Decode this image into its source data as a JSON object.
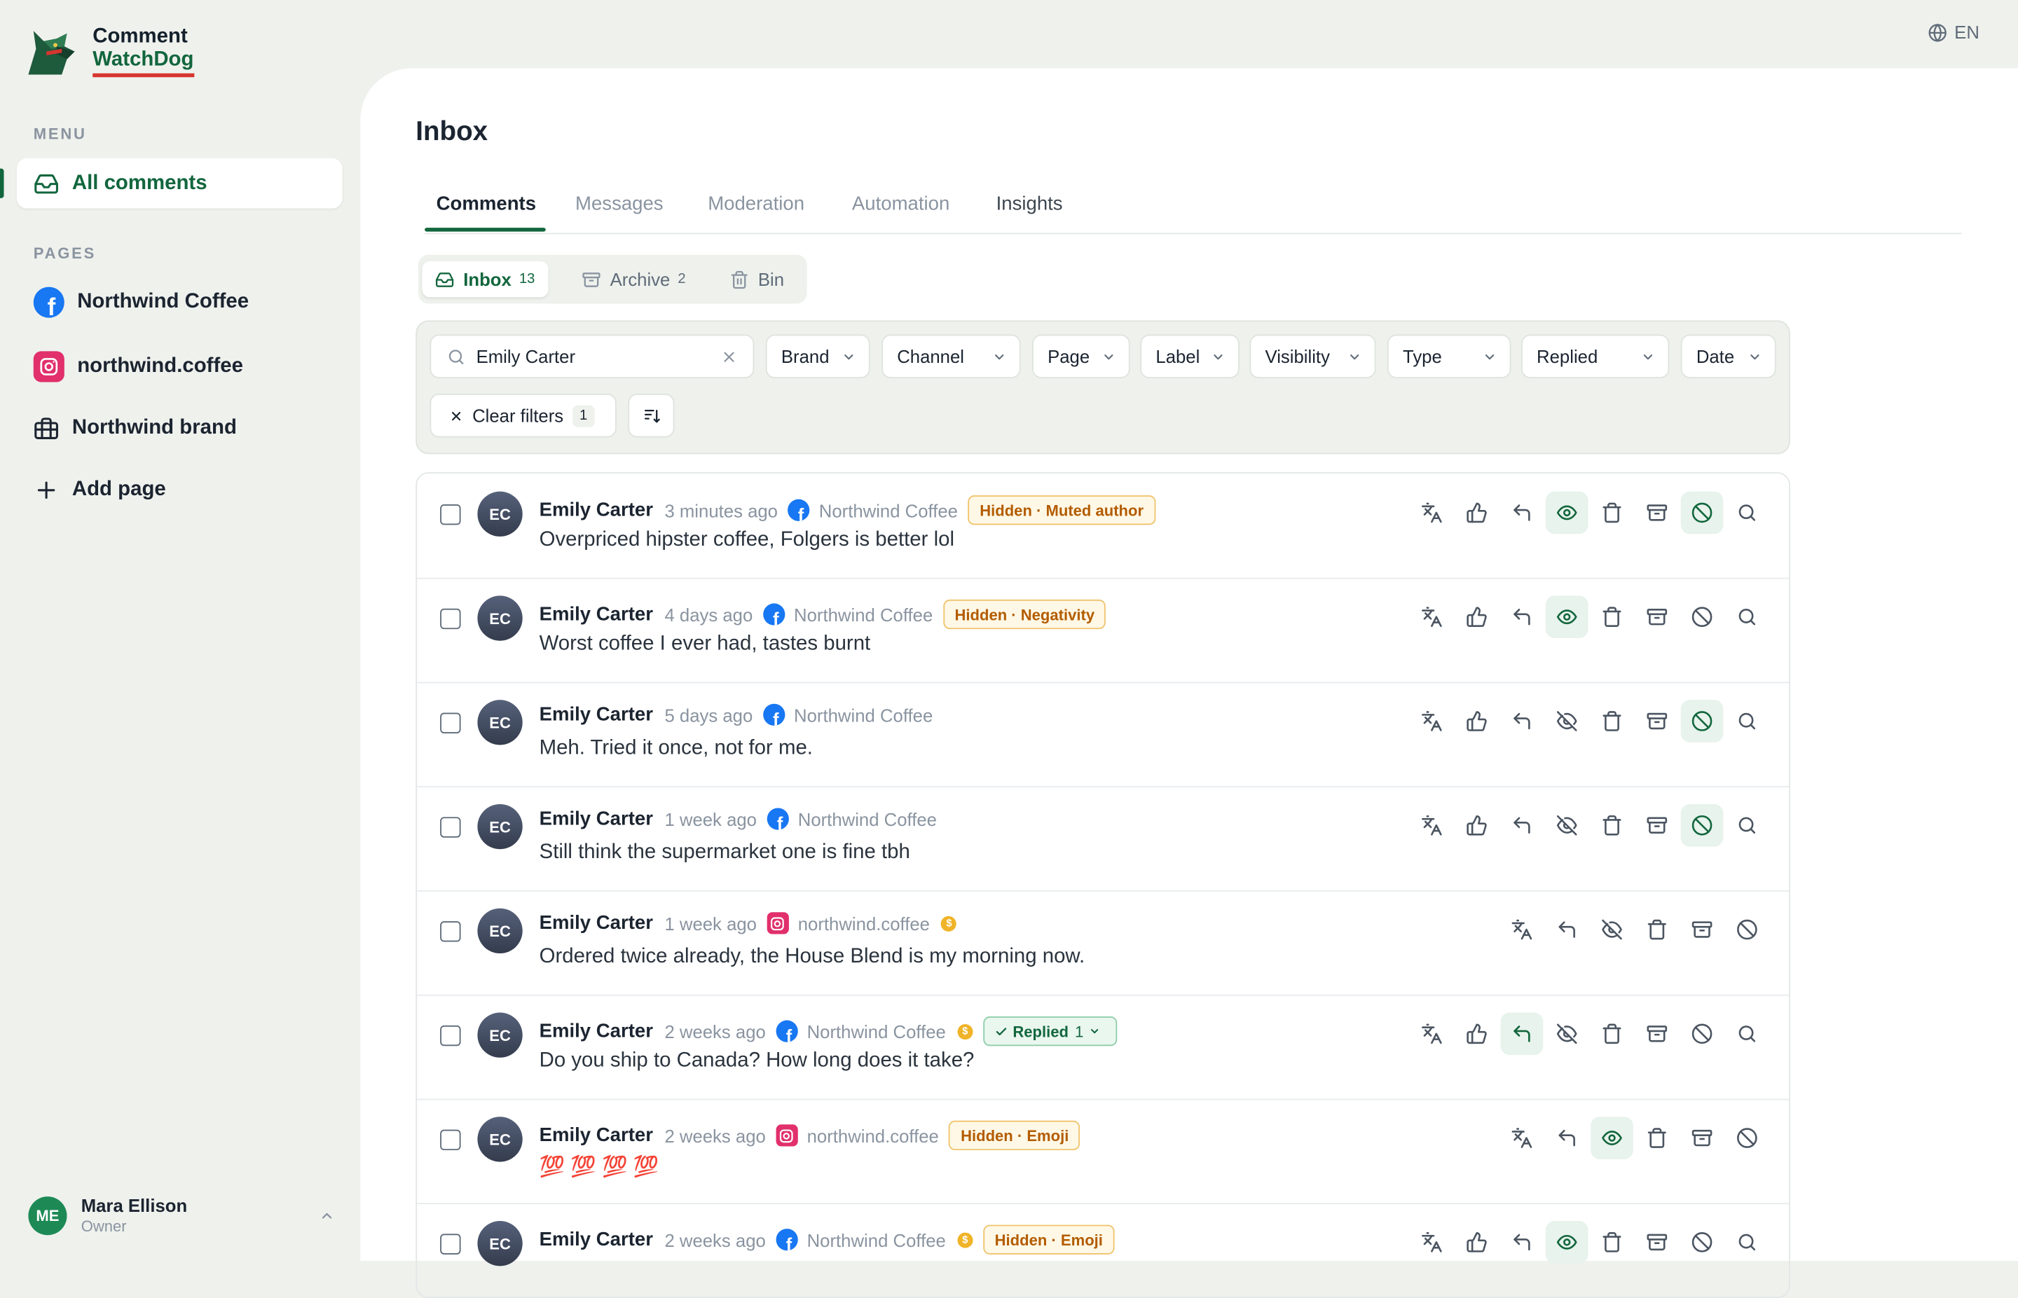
{
  "brand": {
    "line1": "Comment",
    "line2": "WatchDog"
  },
  "lang": "EN",
  "sidebar": {
    "menu_label": "MENU",
    "all_comments": "All comments",
    "pages_label": "PAGES",
    "pages": [
      {
        "label": "Northwind Coffee",
        "icon": "facebook-icon"
      },
      {
        "label": "northwind.coffee",
        "icon": "instagram-icon"
      },
      {
        "label": "Northwind brand",
        "icon": "briefcase-icon"
      }
    ],
    "add_page": "Add page",
    "user": {
      "initials": "ME",
      "name": "Mara Ellison",
      "role": "Owner"
    }
  },
  "main": {
    "title": "Inbox",
    "tabs": [
      "Comments",
      "Messages",
      "Moderation",
      "Automation",
      "Insights"
    ],
    "segments": [
      {
        "label": "Inbox",
        "count": "13"
      },
      {
        "label": "Archive",
        "count": "2"
      },
      {
        "label": "Bin",
        "count": ""
      }
    ],
    "search": {
      "value": "Emily Carter"
    },
    "filters": [
      "Brand",
      "Channel",
      "Page",
      "Label",
      "Visibility",
      "Type",
      "Replied",
      "Date"
    ],
    "clear_filters": {
      "label": "Clear filters",
      "count": "1"
    }
  },
  "colors": {
    "accent": "#12663d",
    "facebook": "#1877f2",
    "instagram": "#e1306c",
    "hidden_badge": "#b35c00",
    "logo_underline": "#d7352f"
  },
  "comments": [
    {
      "initials": "EC",
      "author": "Emily Carter",
      "time": "3 minutes ago",
      "channel": "facebook",
      "page": "Northwind Coffee",
      "coin": false,
      "badge": "Hidden · Muted author",
      "replied": null,
      "text": "Overpriced hipster coffee, Folgers is better lol"
    },
    {
      "initials": "EC",
      "author": "Emily Carter",
      "time": "4 days ago",
      "channel": "facebook",
      "page": "Northwind Coffee",
      "coin": false,
      "badge": "Hidden · Negativity",
      "replied": null,
      "text": "Worst coffee I ever had, tastes burnt"
    },
    {
      "initials": "EC",
      "author": "Emily Carter",
      "time": "5 days ago",
      "channel": "facebook",
      "page": "Northwind Coffee",
      "coin": false,
      "badge": "",
      "replied": null,
      "text": "Meh. Tried it once, not for me."
    },
    {
      "initials": "EC",
      "author": "Emily Carter",
      "time": "1 week ago",
      "channel": "facebook",
      "page": "Northwind Coffee",
      "coin": false,
      "badge": "",
      "replied": null,
      "text": "Still think the supermarket one is fine tbh"
    },
    {
      "initials": "EC",
      "author": "Emily Carter",
      "time": "1 week ago",
      "channel": "instagram",
      "page": "northwind.coffee",
      "coin": true,
      "badge": "",
      "replied": null,
      "text": "Ordered twice already, the House Blend is my morning now."
    },
    {
      "initials": "EC",
      "author": "Emily Carter",
      "time": "2 weeks ago",
      "channel": "facebook",
      "page": "Northwind Coffee",
      "coin": true,
      "badge": "",
      "replied": {
        "label": "Replied",
        "count": "1"
      },
      "text": "Do you ship to Canada? How long does it take?"
    },
    {
      "initials": "EC",
      "author": "Emily Carter",
      "time": "2 weeks ago",
      "channel": "instagram",
      "page": "northwind.coffee",
      "coin": false,
      "badge": "Hidden · Emoji",
      "replied": null,
      "text": "💯 💯 💯 💯"
    },
    {
      "initials": "EC",
      "author": "Emily Carter",
      "time": "2 weeks ago",
      "channel": "facebook",
      "page": "Northwind Coffee",
      "coin": true,
      "badge": "Hidden · Emoji",
      "replied": null,
      "text": ""
    }
  ],
  "row_actions": [
    [
      "translate",
      "like",
      "reply",
      "visible:on",
      "delete",
      "archive",
      "block:on",
      "search"
    ],
    [
      "translate",
      "like",
      "reply",
      "visible:on",
      "delete",
      "archive",
      "block",
      "search"
    ],
    [
      "translate",
      "like",
      "reply",
      "hidden",
      "delete",
      "archive",
      "block:on",
      "search"
    ],
    [
      "translate",
      "like",
      "reply",
      "hidden",
      "delete",
      "archive",
      "block:on",
      "search"
    ],
    [
      "translate",
      "reply",
      "hidden",
      "delete",
      "archive",
      "block"
    ],
    [
      "translate",
      "like",
      "reply:on",
      "hidden",
      "delete",
      "archive",
      "block",
      "search"
    ],
    [
      "translate",
      "reply",
      "visible:on",
      "delete",
      "archive",
      "block"
    ],
    [
      "translate",
      "like",
      "reply",
      "visible:on",
      "delete",
      "archive",
      "block",
      "search"
    ]
  ]
}
